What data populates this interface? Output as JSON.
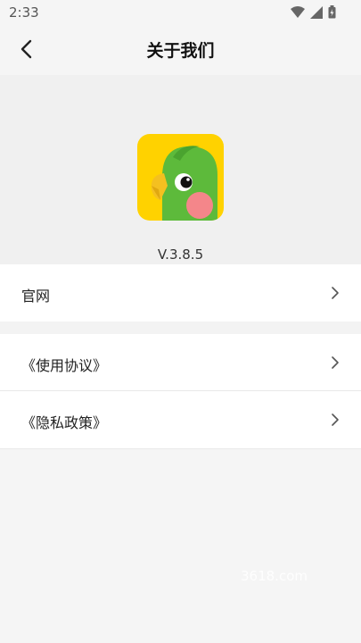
{
  "status_bar": {
    "time": "2:33",
    "icons": [
      "wifi-icon",
      "signal-icon",
      "battery-icon"
    ]
  },
  "header": {
    "back_icon": "chevron-left-icon",
    "title": "关于我们"
  },
  "about": {
    "logo_icon": "parrot-app-logo",
    "version": "V.3.8.5"
  },
  "menu": {
    "website_label": "官网",
    "terms_label": "《使用协议》",
    "privacy_label": "《隐私政策》",
    "chevron_icon": "chevron-right-icon"
  },
  "watermark": "3618.com",
  "colors": {
    "background": "#f5f5f5",
    "logo_bg": "#FFD200",
    "parrot_green": "#5DBA3B",
    "beak": "#F4C020",
    "cheek": "#F4868A"
  }
}
